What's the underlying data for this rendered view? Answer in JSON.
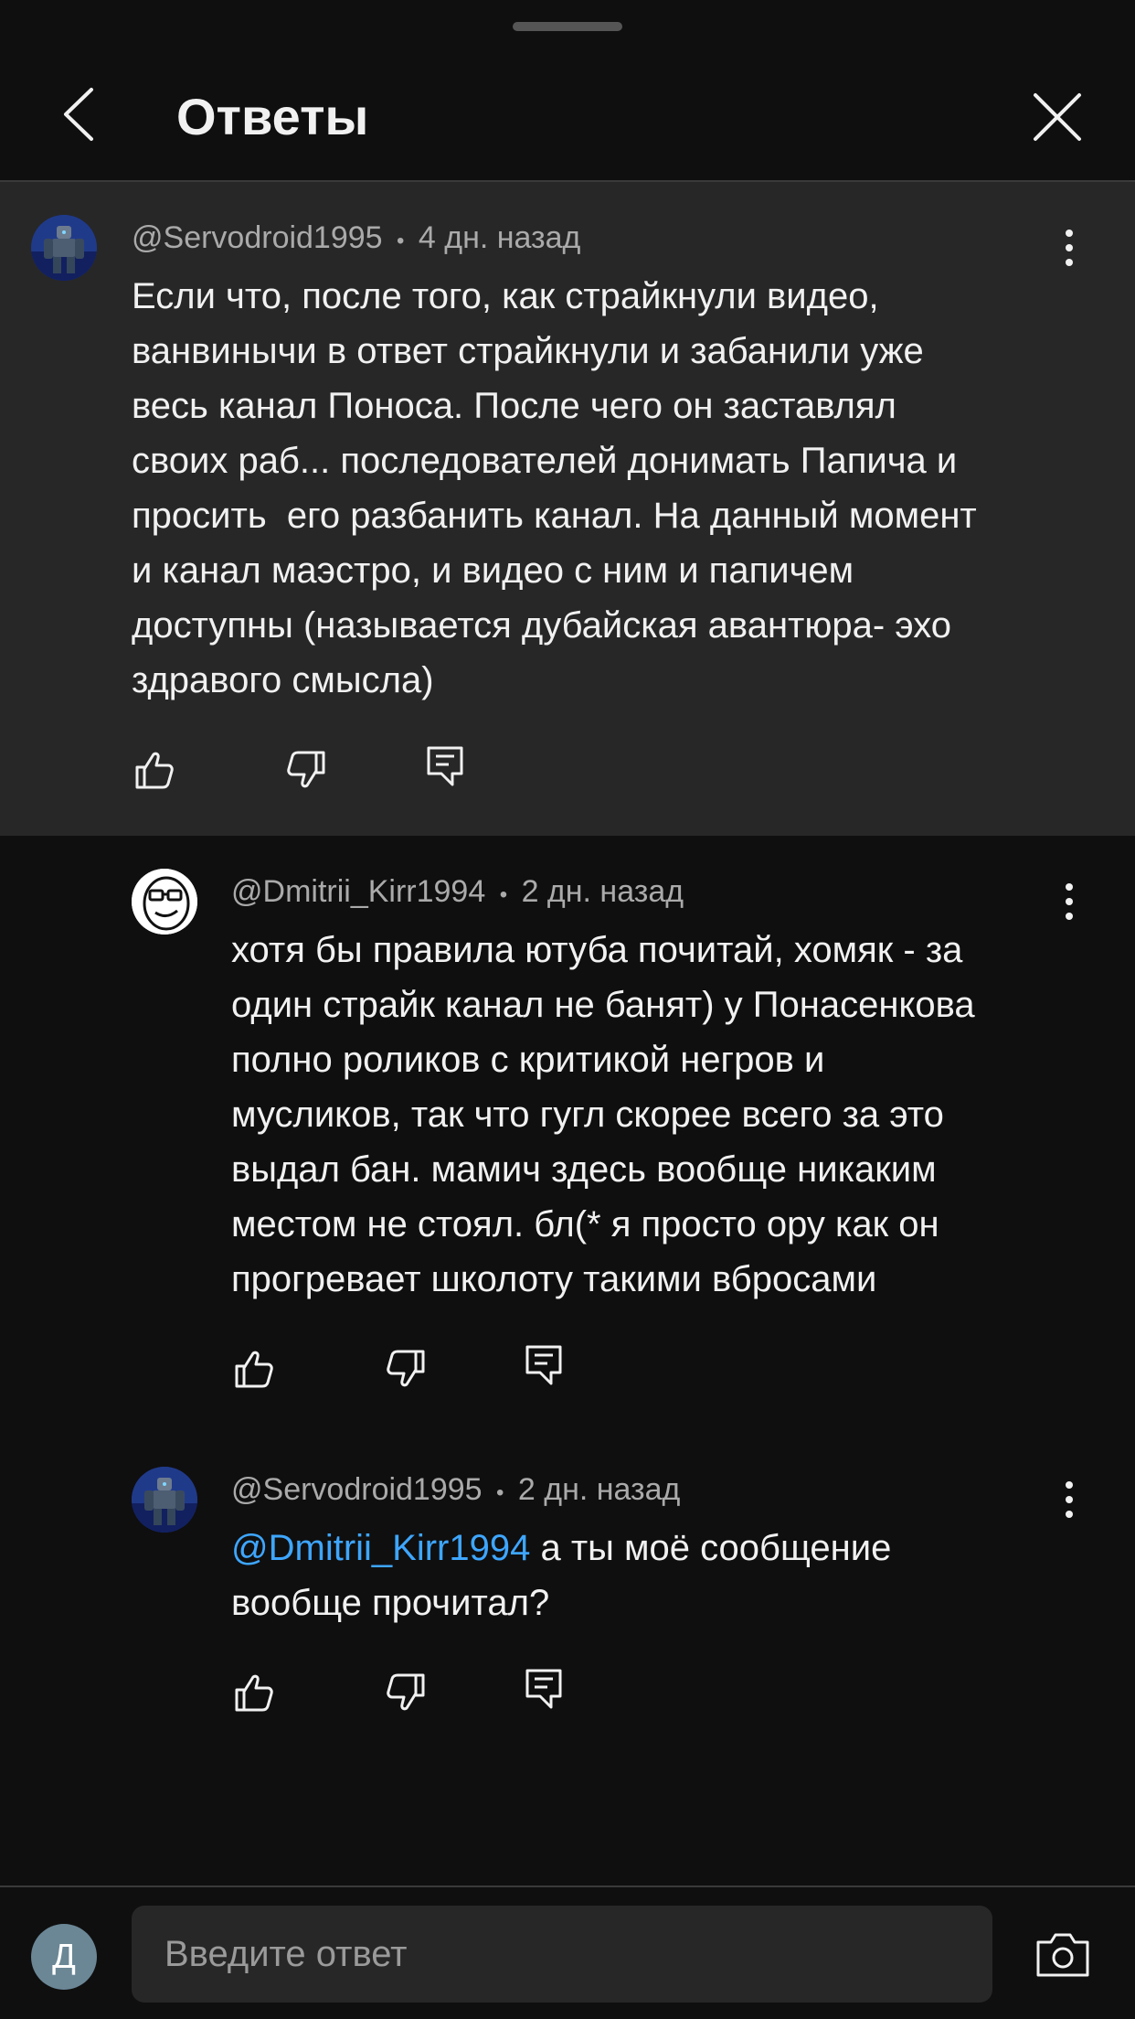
{
  "header": {
    "title": "Ответы"
  },
  "comments": [
    {
      "author": "@Servodroid1995",
      "separator": "•",
      "time": "4 дн. назад",
      "lines": [
        "Если что, после того, как страйкнули видео,",
        "ванвинычи в ответ страйкнули и забанили уже",
        "весь канал Поноса. После чего он заставлял",
        "своих раб... последователей донимать Папича и",
        "просить  его разбанить канал. На данный момент",
        "и канал маэстро, и видео с ним и папичем",
        "доступны (называется дубайская авантюра- эхо",
        "здравого смысла)"
      ],
      "icons": {
        "avatar": "robot-avatar",
        "like": "thumb-up-icon",
        "dislike": "thumb-down-icon",
        "reply": "reply-icon",
        "more": "more-vertical-icon"
      }
    },
    {
      "author": "@Dmitrii_Kirr1994",
      "separator": "•",
      "time": "2 дн. назад",
      "lines": [
        "хотя бы правила ютуба почитай, хомяк - за",
        "один страйк канал не банят) у Понасенкова",
        "полно роликов с критикой негров и",
        "мусликов, так что гугл скорее всего за это",
        "выдал бан. мамич здесь вообще никаким",
        "местом не стоял. бл(* я просто ору как он",
        "прогревает школоту такими вбросами"
      ],
      "icons": {
        "avatar": "meme-face-avatar",
        "like": "thumb-up-icon",
        "dislike": "thumb-down-icon",
        "reply": "reply-icon",
        "more": "more-vertical-icon"
      }
    },
    {
      "author": "@Servodroid1995",
      "separator": "•",
      "time": "2 дн. назад",
      "mention": "@Dmitrii_Kirr1994",
      "line1_rest": " а ты моё сообщение",
      "line2": "вообще прочитал?",
      "icons": {
        "avatar": "robot-avatar",
        "like": "thumb-up-icon",
        "dislike": "thumb-down-icon",
        "reply": "reply-icon",
        "more": "more-vertical-icon"
      }
    }
  ],
  "reply_bar": {
    "avatar_letter": "Д",
    "placeholder": "Введите ответ",
    "value": "",
    "camera_icon": "camera-icon"
  },
  "colors": {
    "background": "#0f0f0f",
    "highlight_background": "#272727",
    "mention": "#3ea6ff",
    "meta_text": "#aaaaaa",
    "user_avatar": "#6b8796"
  }
}
